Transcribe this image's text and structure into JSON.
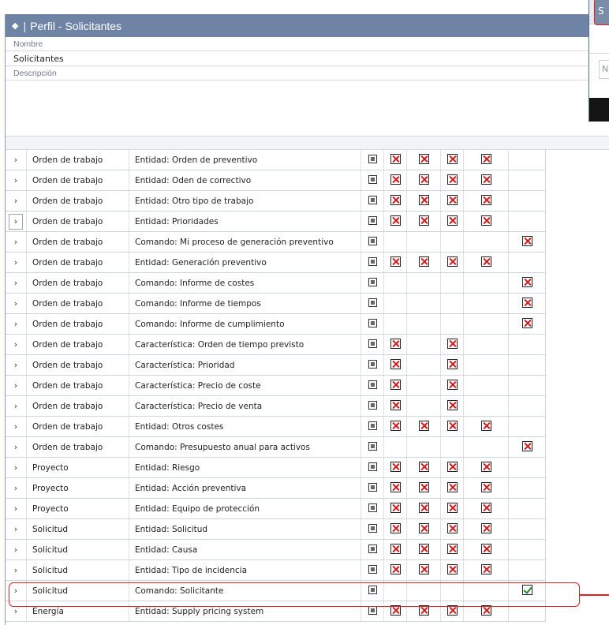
{
  "header": {
    "title": "Perfil -  Solicitantes"
  },
  "form": {
    "name_label": "Nombre",
    "name_value": "Solicitantes",
    "description_label": "Descripción",
    "description_value": ""
  },
  "overlay": {
    "header_fragment": "S",
    "field_fragment": "N"
  },
  "rows": [
    {
      "module": "Orden de trabajo",
      "object": "Entidad: Orden de preventivo",
      "cells": [
        "sq",
        "x",
        "x",
        "x",
        "x",
        ""
      ]
    },
    {
      "module": "Orden de trabajo",
      "object": "Entidad: Oden de correctivo",
      "cells": [
        "sq",
        "x",
        "x",
        "x",
        "x",
        ""
      ]
    },
    {
      "module": "Orden de trabajo",
      "object": "Entidad: Otro tipo de trabajo",
      "cells": [
        "sq",
        "x",
        "x",
        "x",
        "x",
        ""
      ]
    },
    {
      "module": "Orden de trabajo",
      "object": "Entidad: Prioridades",
      "cells": [
        "sq",
        "x",
        "x",
        "x",
        "x",
        ""
      ]
    },
    {
      "module": "Orden de trabajo",
      "object": "Comando: Mi proceso de generación preventivo",
      "cells": [
        "sq",
        "",
        "",
        "",
        "",
        "x"
      ]
    },
    {
      "module": "Orden de trabajo",
      "object": "Entidad: Generación preventivo",
      "cells": [
        "sq",
        "x",
        "x",
        "x",
        "x",
        ""
      ]
    },
    {
      "module": "Orden de trabajo",
      "object": "Comando: Informe de costes",
      "cells": [
        "sq",
        "",
        "",
        "",
        "",
        "x"
      ]
    },
    {
      "module": "Orden de trabajo",
      "object": "Comando: Informe de tiempos",
      "cells": [
        "sq",
        "",
        "",
        "",
        "",
        "x"
      ]
    },
    {
      "module": "Orden de trabajo",
      "object": "Comando: Informe de cumplimiento",
      "cells": [
        "sq",
        "",
        "",
        "",
        "",
        "x"
      ]
    },
    {
      "module": "Orden de trabajo",
      "object": "Característica: Orden de tiempo previsto",
      "cells": [
        "sq",
        "x",
        "",
        "x",
        "",
        ""
      ]
    },
    {
      "module": "Orden de trabajo",
      "object": "Característica: Prioridad",
      "cells": [
        "sq",
        "x",
        "",
        "x",
        "",
        ""
      ]
    },
    {
      "module": "Orden de trabajo",
      "object": "Característica: Precio de coste",
      "cells": [
        "sq",
        "x",
        "",
        "x",
        "",
        ""
      ]
    },
    {
      "module": "Orden de trabajo",
      "object": "Característica: Precio de venta",
      "cells": [
        "sq",
        "x",
        "",
        "x",
        "",
        ""
      ]
    },
    {
      "module": "Orden de trabajo",
      "object": "Entidad: Otros costes",
      "cells": [
        "sq",
        "x",
        "x",
        "x",
        "x",
        ""
      ]
    },
    {
      "module": "Orden de trabajo",
      "object": "Comando: Presupuesto anual para activos",
      "cells": [
        "sq",
        "",
        "",
        "",
        "",
        "x"
      ]
    },
    {
      "module": "Proyecto",
      "object": "Entidad: Riesgo",
      "cells": [
        "sq",
        "x",
        "x",
        "x",
        "x",
        ""
      ]
    },
    {
      "module": "Proyecto",
      "object": "Entidad: Acción preventiva",
      "cells": [
        "sq",
        "x",
        "x",
        "x",
        "x",
        ""
      ]
    },
    {
      "module": "Proyecto",
      "object": "Entidad: Equipo de protección",
      "cells": [
        "sq",
        "x",
        "x",
        "x",
        "x",
        ""
      ]
    },
    {
      "module": "Solicitud",
      "object": "Entidad: Solicitud",
      "cells": [
        "sq",
        "x",
        "x",
        "x",
        "x",
        ""
      ]
    },
    {
      "module": "Solicitud",
      "object": "Entidad: Causa",
      "cells": [
        "sq",
        "x",
        "x",
        "x",
        "x",
        ""
      ]
    },
    {
      "module": "Solicitud",
      "object": "Entidad: Tipo de incidencia",
      "cells": [
        "sq",
        "x",
        "x",
        "x",
        "x",
        ""
      ]
    },
    {
      "module": "Solicitud",
      "object": "Comando: Solicitante",
      "cells": [
        "sq",
        "",
        "",
        "",
        "",
        "check"
      ]
    },
    {
      "module": "Energía",
      "object": "Entidad: Supply pricing system",
      "cells": [
        "sq",
        "x",
        "x",
        "x",
        "x",
        ""
      ]
    }
  ],
  "selected_row_index": 3,
  "highlighted_row_index": 21,
  "colors": {
    "titlebar": "#6f84a5",
    "highlight": "#dd2222",
    "deny": "#d11a1a",
    "allow": "#1c8a1c"
  }
}
